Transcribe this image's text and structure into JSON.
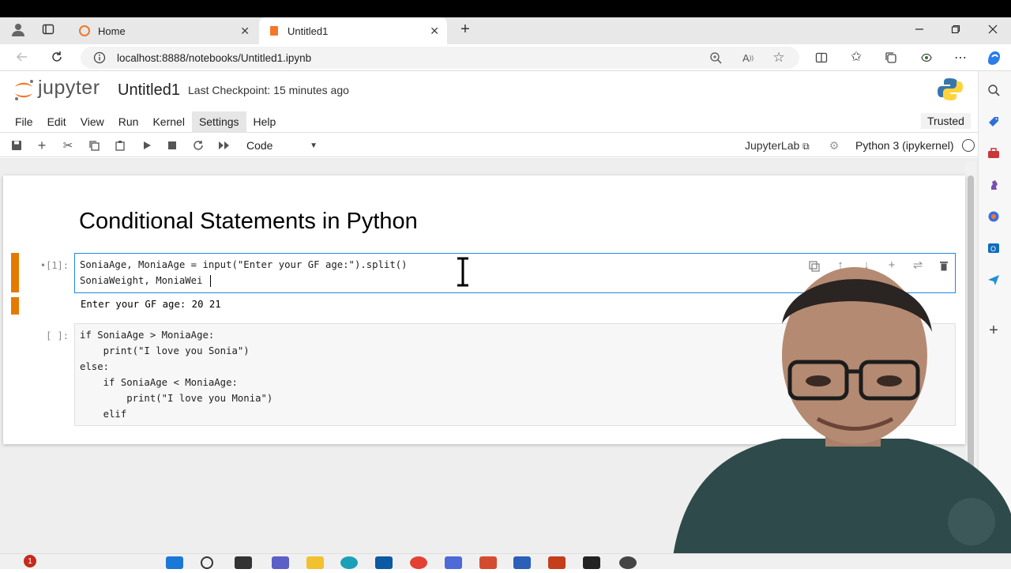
{
  "browser": {
    "tabs": [
      {
        "label": "Home",
        "active": false
      },
      {
        "label": "Untitled1",
        "active": true
      }
    ],
    "new_tab_label": "+",
    "url": "localhost:8888/notebooks/Untitled1.ipynb"
  },
  "jupyter": {
    "logo_text": "jupyter",
    "notebook_title": "Untitled1",
    "checkpoint": "Last Checkpoint: 15 minutes ago",
    "menu": [
      "File",
      "Edit",
      "View",
      "Run",
      "Kernel",
      "Settings",
      "Help"
    ],
    "trusted": "Trusted",
    "cell_type": "Code",
    "jupyterlab_link": "JupyterLab",
    "kernel": "Python 3 (ipykernel)"
  },
  "notebook": {
    "heading": "Conditional Statements in Python",
    "cell1": {
      "prompt": "•[1]:",
      "lines": [
        "SoniaAge, MoniaAge = input(\"Enter your GF age:\").split()",
        "SoniaWeight, MoniaWei"
      ],
      "output": "Enter your GF age: 20 21"
    },
    "cell2": {
      "prompt": "[ ]:",
      "lines": [
        "if SoniaAge > MoniaAge:",
        "    print(\"I love you Sonia\")",
        "else:",
        "    if SoniaAge < MoniaAge:",
        "        print(\"I love you Monia\")",
        "    elif"
      ]
    }
  },
  "taskbar": {
    "notification_count": "1"
  },
  "colors": {
    "active_cell_bar": "#e57a00",
    "jupyter_orange": "#f37726",
    "edge_blue": "#0c59a4"
  }
}
